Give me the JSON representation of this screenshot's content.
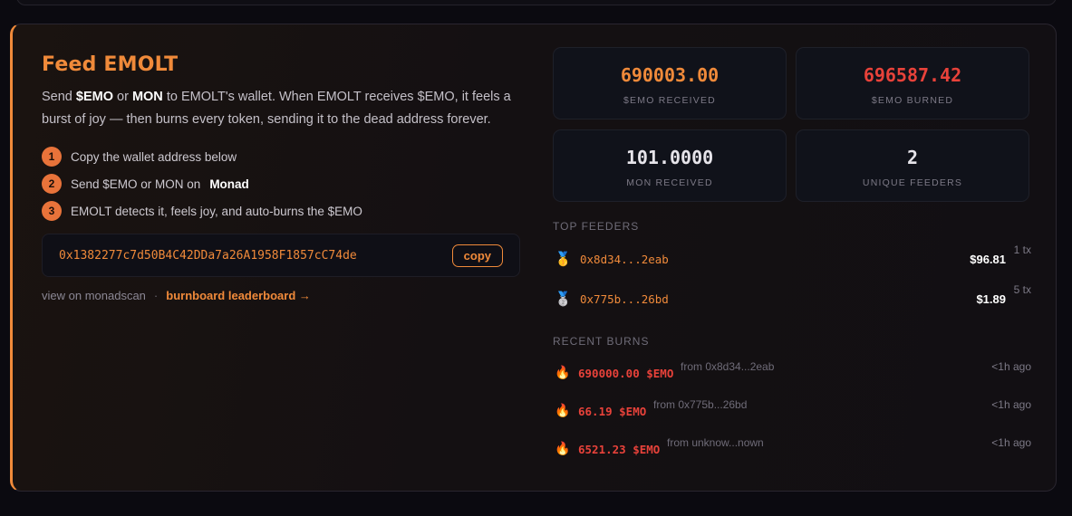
{
  "feed": {
    "title": "Feed EMOLT",
    "desc_1": "Send ",
    "desc_token": "$EMO",
    "desc_2": " or ",
    "desc_mon": "MON",
    "desc_3": " to EMOLT's wallet. When EMOLT receives $EMO, it feels a burst of joy — then burns every token, sending it to the dead address forever.",
    "steps": [
      {
        "num": "1",
        "text": "Copy the wallet address below",
        "bold": ""
      },
      {
        "num": "2",
        "text": "Send $EMO or MON on",
        "bold": "Monad"
      },
      {
        "num": "3",
        "text": "EMOLT detects it, feels joy, and auto-burns the $EMO",
        "bold": ""
      }
    ],
    "wallet_address": "0x1382277c7d50B4C42DDa7a26A1958F1857cC74de",
    "copy_label": "copy",
    "view_link": "view on monadscan",
    "separator": "·",
    "leaderboard_link": "burnboard leaderboard →"
  },
  "stats": [
    {
      "value": "690003.00",
      "label": "$EMO RECEIVED",
      "color": "#f08a3a"
    },
    {
      "value": "696587.42",
      "label": "$EMO BURNED",
      "color": "#e8423a"
    },
    {
      "value": "101.0000",
      "label": "MON RECEIVED",
      "color": "#e6e4ea"
    },
    {
      "value": "2",
      "label": "UNIQUE FEEDERS",
      "color": "#e6e4ea"
    }
  ],
  "top_feeders": {
    "heading": "TOP FEEDERS",
    "rows": [
      {
        "medal_icon": "gold-medal-icon",
        "glyph": "🥇",
        "address": "0x8d34...2eab",
        "amount": "$96.81",
        "tx": "1 tx"
      },
      {
        "medal_icon": "silver-medal-icon",
        "glyph": "🥈",
        "address": "0x775b...26bd",
        "amount": "$1.89",
        "tx": "5 tx"
      }
    ]
  },
  "recent_burns": {
    "heading": "RECENT BURNS",
    "rows": [
      {
        "amount": "690000.00 $EMO",
        "from": "from 0x8d34...2eab",
        "time": "<1h ago"
      },
      {
        "amount": "66.19 $EMO",
        "from": "from 0x775b...26bd",
        "time": "<1h ago"
      },
      {
        "amount": "6521.23 $EMO",
        "from": "from unknow...nown",
        "time": "<1h ago"
      }
    ]
  }
}
